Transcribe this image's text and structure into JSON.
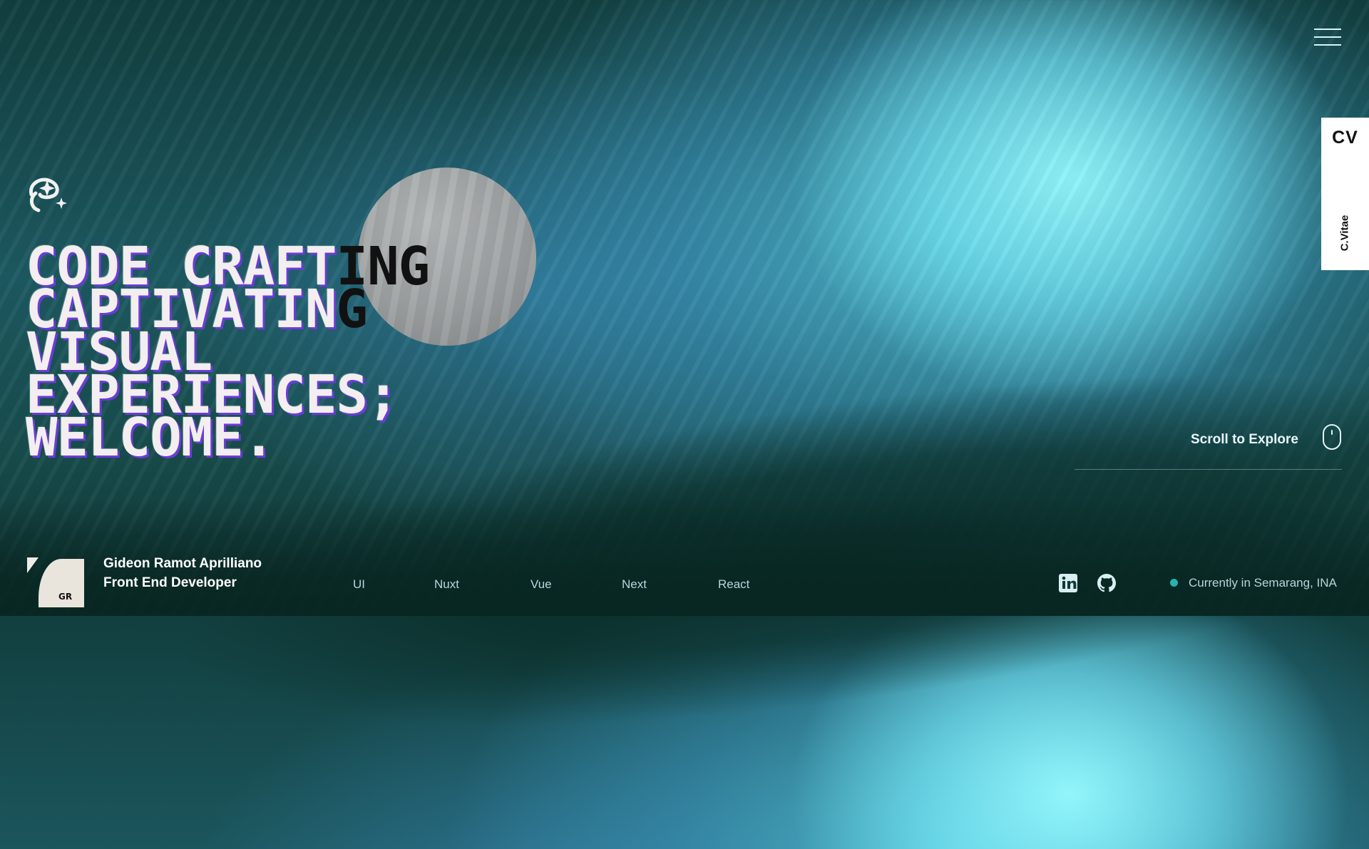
{
  "hero": {
    "lines": [
      {
        "light": "CODE CRAFT",
        "dark": "ING"
      },
      {
        "light": "CAPTIVATIN",
        "dark": "G"
      },
      {
        "light": "VISUAL",
        "dark": ""
      },
      {
        "light": "EXPERIENCES;",
        "dark": ""
      },
      {
        "light": "WELCOME.",
        "dark": ""
      }
    ]
  },
  "cv_tab": {
    "title": "CV",
    "subtitle": "C.Vitae"
  },
  "scroll": {
    "label": "Scroll to Explore"
  },
  "profile": {
    "initials": "GR",
    "name": "Gideon Ramot Aprilliano",
    "role": "Front End Developer"
  },
  "tech_stack": [
    "UI",
    "Nuxt",
    "Vue",
    "Next",
    "React"
  ],
  "social": [
    {
      "icon": "linkedin-icon"
    },
    {
      "icon": "github-icon"
    }
  ],
  "status": {
    "text": "Currently in Semarang, INA",
    "dot_color": "#27b3ae"
  },
  "colors": {
    "accent_shadow": "#6c3bd8",
    "cv_background": "#ffffff"
  }
}
